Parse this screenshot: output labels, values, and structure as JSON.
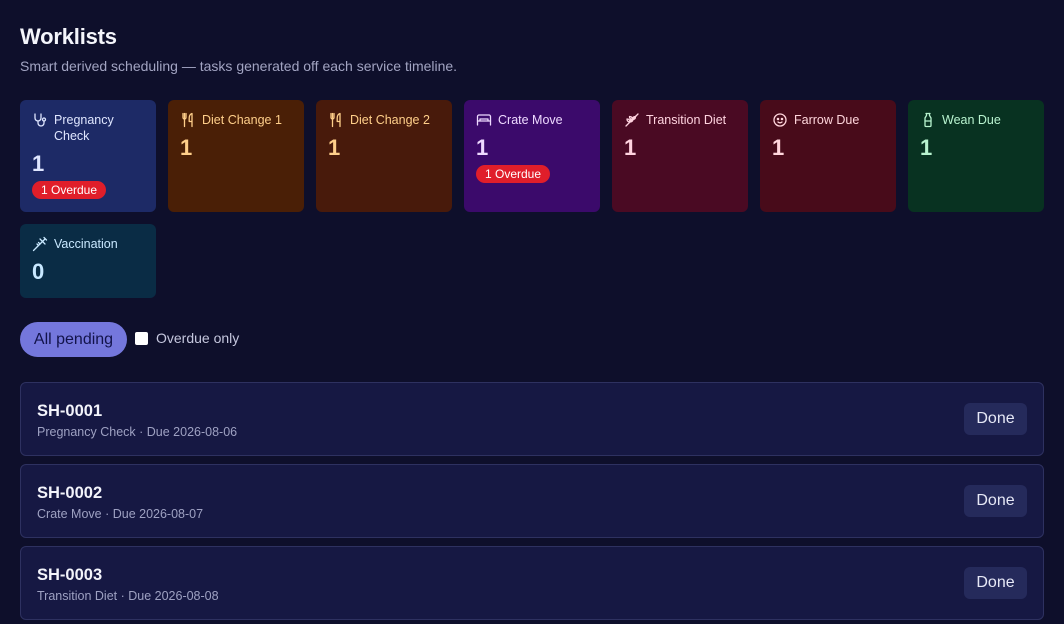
{
  "header": {
    "title": "Worklists",
    "subtitle": "Smart derived scheduling — tasks generated off each service timeline."
  },
  "cards": [
    {
      "label": "Pregnancy Check",
      "count": "1",
      "badge": "1 Overdue",
      "icon": "stethoscope-icon",
      "bg": "#1d2a66",
      "fg": "#dfe6ff"
    },
    {
      "label": "Diet Change 1",
      "count": "1",
      "badge": "",
      "icon": "utensils-icon",
      "bg": "#4a1f06",
      "fg": "#ffcf8a"
    },
    {
      "label": "Diet Change 2",
      "count": "1",
      "badge": "",
      "icon": "utensils-icon",
      "bg": "#481a0b",
      "fg": "#ffcf8a"
    },
    {
      "label": "Crate Move",
      "count": "1",
      "badge": "1 Overdue",
      "icon": "bed-icon",
      "bg": "#3b0a6b",
      "fg": "#eed9ff"
    },
    {
      "label": "Transition Diet",
      "count": "1",
      "badge": "",
      "icon": "wheat-icon",
      "bg": "#4a0a23",
      "fg": "#ffd3df"
    },
    {
      "label": "Farrow Due",
      "count": "1",
      "badge": "",
      "icon": "baby-icon",
      "bg": "#480b1a",
      "fg": "#ffd6dc"
    },
    {
      "label": "Wean Due",
      "count": "1",
      "badge": "",
      "icon": "milk-bottle-icon",
      "bg": "#083221",
      "fg": "#b8f3cf"
    },
    {
      "label": "Vaccination",
      "count": "0",
      "badge": "",
      "icon": "syringe-icon",
      "bg": "#0a2c45",
      "fg": "#c8e8ff"
    }
  ],
  "filters": {
    "all_pending_label": "All pending",
    "overdue_only_label": "Overdue only",
    "overdue_only_checked": false
  },
  "tasks": [
    {
      "id": "SH-0001",
      "meta": "Pregnancy Check · Due 2026-08-06",
      "action": "Done"
    },
    {
      "id": "SH-0002",
      "meta": "Crate Move · Due 2026-08-07",
      "action": "Done"
    },
    {
      "id": "SH-0003",
      "meta": "Transition Diet · Due 2026-08-08",
      "action": "Done"
    }
  ],
  "colors": {
    "background": "#0e0f2b",
    "accent": "#7477dc",
    "overdue": "#e01e2a"
  }
}
